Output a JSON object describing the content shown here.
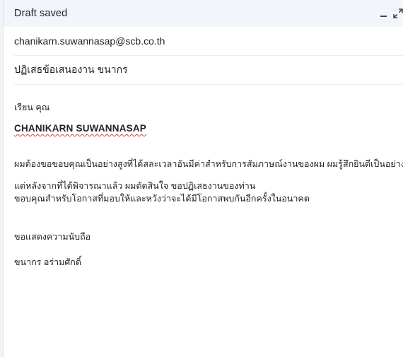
{
  "compose": {
    "status": "Draft saved",
    "minimize_icon": "minimize-icon",
    "expand_icon": "expand-icon",
    "to": "chanikarn.suwannasap@scb.co.th",
    "subject": "ปฏิเสธข้อเสนองาน ขนากร"
  },
  "body": {
    "greeting": "เรียน คุณ",
    "recipient_name": "CHANIKARN SUWANNASAP",
    "paragraph1": "ผมต้องขอขอบคุณเป็นอย่างสูงที่ได้สละเวลาอันมีค่าสำหรับการสัมภาษณ์งานของผม ผมรู้สึกยินดีเป็นอย่างยิ่งที่",
    "paragraph2_line1": "แต่หลังจากที่ได้พิจารณาแล้ว ผมตัดสินใจ ขอปฏิเสธงานของท่าน",
    "paragraph2_line2": "ขอบคุณสำหรับโอกาสที่มอบให้และหวังว่าจะได้มีโอกาสพบกันอีกครั้งในอนาคต",
    "closing": "ขอแสดงความนับถือ",
    "signature": "ขนากร อร่ามศักดิ์"
  },
  "colors": {
    "header_bg": "#f2f6fc",
    "spellcheck_underline": "#e53935"
  }
}
